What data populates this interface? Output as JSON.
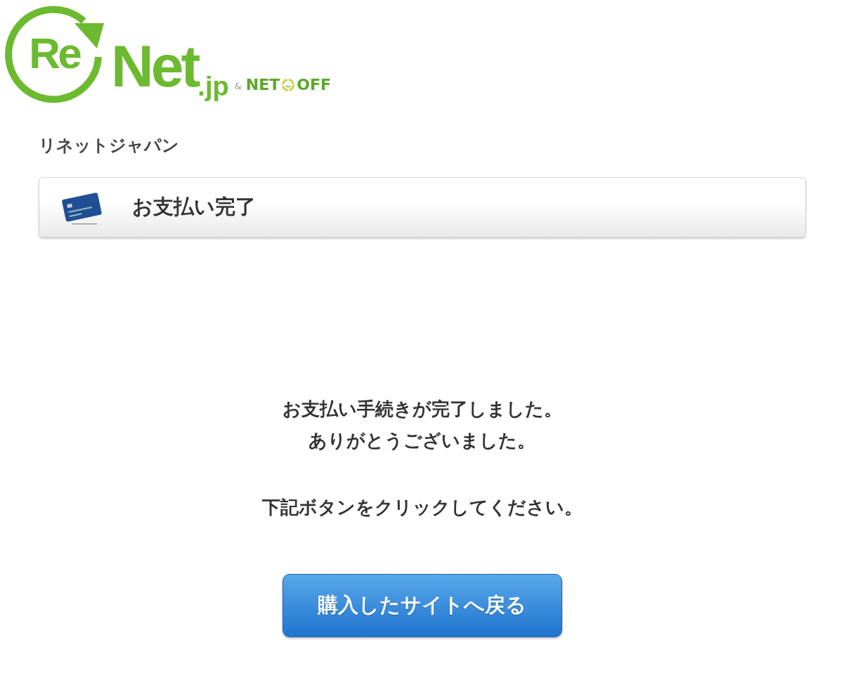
{
  "logo": {
    "mark": "Re",
    "name": "Net",
    "suffix": ".jp",
    "ampersand": "&",
    "partner_left": "NET",
    "partner_right": "OFF"
  },
  "company": "リネットジャパン",
  "header": {
    "title": "お支払い完了"
  },
  "message_groups": [
    [
      "お支払い手続きが完了しました。",
      "ありがとうございました。"
    ],
    [
      "下記ボタンをクリックしてください。"
    ]
  ],
  "button": "購入したサイトへ戻る"
}
